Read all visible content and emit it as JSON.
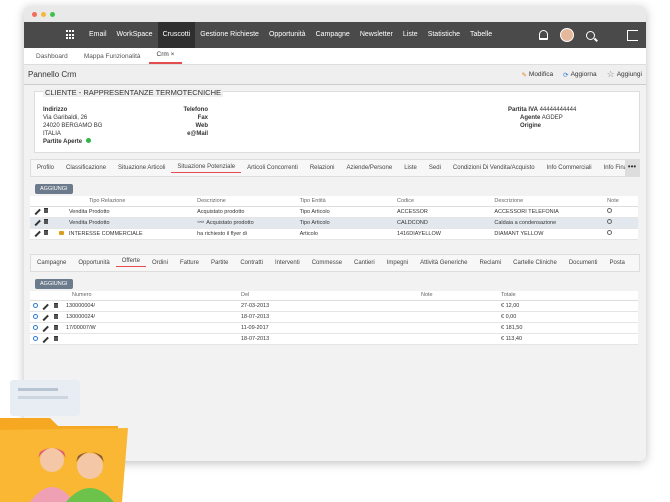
{
  "nav": {
    "items": [
      "Email",
      "WorkSpace",
      "Cruscotti",
      "Gestione Richieste",
      "Opportunità",
      "Campagne",
      "Newsletter",
      "Liste",
      "Statistiche",
      "Tabelle"
    ],
    "active_index": 2
  },
  "tabs": [
    {
      "label": "Dashboard"
    },
    {
      "label": "Mappa Funzionalità"
    },
    {
      "label": "Crm",
      "close": "×"
    }
  ],
  "panel": {
    "title": "Pannello Crm",
    "actions": {
      "modifica": "Modifica",
      "aggiorna": "Aggiorna",
      "aggiungi": "Aggiungi"
    }
  },
  "customer": {
    "title": "CLIENTE - RAPPRESENTANZE TERMOTECNICHE",
    "indirizzo_label": "Indirizzo",
    "address1": "Via Garibaldi, 26",
    "address2": "24020 BERGAMO BG",
    "country": "ITALIA",
    "partite_aperte": "Partite Aperte",
    "telefono": "Telefono",
    "fax": "Fax",
    "web": "Web",
    "email": "e@Mail",
    "partita_iva_label": "Partita IVA",
    "partita_iva": "44444444444",
    "agente_label": "Agente",
    "agente": "AGDEP",
    "origine_label": "Origine"
  },
  "subtabs1": [
    "Profilo",
    "Classificazione",
    "Situazione Articoli",
    "Situazione Potenziale",
    "Articoli Concorrenti",
    "Relazioni",
    "Aziende/Persone",
    "Liste",
    "Sedi",
    "Condizioni Di Vendita/Acquisto",
    "Info Commerciali",
    "Info Finanz"
  ],
  "subtabs1_active": 3,
  "more": "•••",
  "add_button": "AGGIUNGI",
  "table1": {
    "headers": [
      "Tipo Relazione",
      "Descrizione",
      "Tipo Entità",
      "Codice",
      "Descrizione",
      "Note"
    ],
    "rows": [
      [
        "Vendita Prodotto",
        "Acquistato prodotto",
        "Tipo Articolo",
        "ACCESSOR",
        "ACCESSORI TELEFONIA"
      ],
      [
        "Vendita Prodotto",
        "Acquistato prodotto",
        "Tipo Articolo",
        "CALDCOND",
        "Caldaia a condensazione"
      ],
      [
        "INTERESSE COMMERCIALE",
        "ha richiesto il flyer di",
        "Articolo",
        "1416DIAYELLOW",
        "DIAMANT YELLOW"
      ]
    ]
  },
  "subtabs2": [
    "Campagne",
    "Opportunità",
    "Offerte",
    "Ordini",
    "Fatture",
    "Partite",
    "Contratti",
    "Interventi",
    "Commesse",
    "Cantieri",
    "Impegni",
    "Attività Generiche",
    "Reclami",
    "Cartelle Cliniche",
    "Documenti",
    "Posta"
  ],
  "subtabs2_active": 2,
  "table2": {
    "headers": [
      "Numero",
      "Del",
      "Note",
      "Totale"
    ],
    "rows": [
      [
        "130000004/",
        "27-03-2013",
        "",
        "€ 12,00"
      ],
      [
        "130000024/",
        "18-07-2013",
        "",
        "€ 0,00"
      ],
      [
        "17/00007/W",
        "11-09-2017",
        "",
        "€ 181,50"
      ],
      [
        "",
        "18-07-2013",
        "",
        "€ 113,40"
      ]
    ]
  },
  "colors": {
    "accent": "#e44d4d",
    "nav": "#4a4a4a",
    "green": "#2fb54a",
    "folder": "#f7a823"
  }
}
